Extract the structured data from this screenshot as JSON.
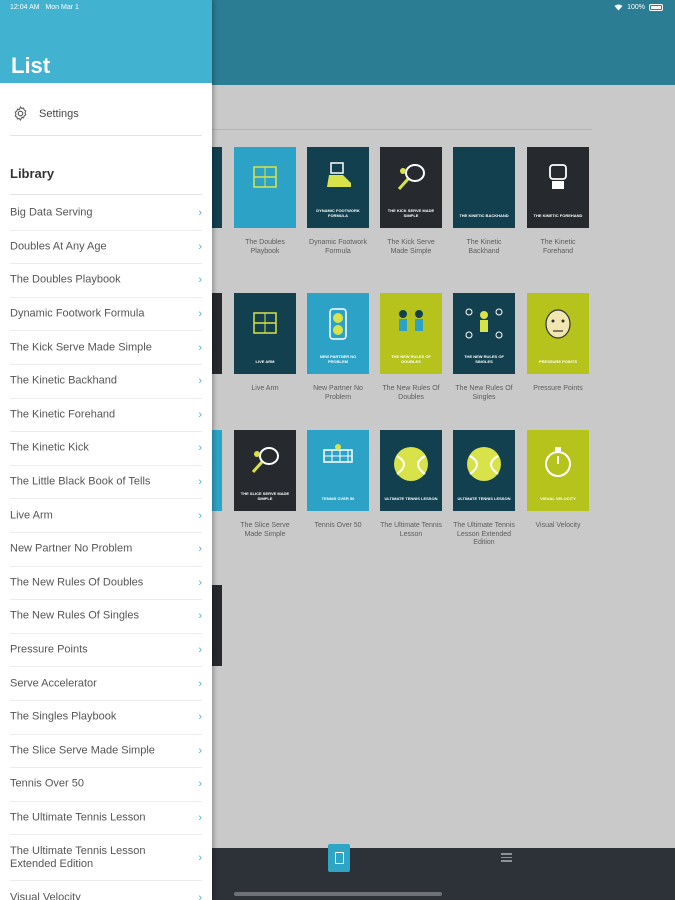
{
  "status_bar": {
    "time": "12:04 AM",
    "date": "Mon Mar 1",
    "battery": "100%"
  },
  "drawer": {
    "title": "List",
    "settings_label": "Settings",
    "library_heading": "Library",
    "items": [
      "Big Data Serving",
      "Doubles At Any Age",
      "The Doubles Playbook",
      "Dynamic Footwork Formula",
      "The Kick Serve Made Simple",
      "The Kinetic Backhand",
      "The Kinetic Forehand",
      "The Kinetic Kick",
      "The Little Black Book of Tells",
      "Live Arm",
      "New Partner No Problem",
      "The New Rules Of Doubles",
      "The New Rules Of Singles",
      "Pressure Points",
      "Serve Accelerator",
      "The Singles Playbook",
      "The Slice Serve Made Simple",
      "Tennis Over 50",
      "The Ultimate Tennis Lesson",
      "The Ultimate Tennis Lesson Extended Edition",
      "Visual Velocity"
    ]
  },
  "grid": {
    "row1": [
      {
        "caption": "The Doubles Playbook",
        "cover_text": "",
        "color": "cyan",
        "icon": "court-icon"
      },
      {
        "caption": "Dynamic Footwork Formula",
        "cover_text": "DYNAMIC FOOTWORK FORMULA",
        "color": "navy",
        "icon": "shoe-icon"
      },
      {
        "caption": "The Kick Serve Made Simple",
        "cover_text": "THE KICK SERVE MADE SIMPLE",
        "color": "dark",
        "icon": "racket-icon"
      },
      {
        "caption": "The Kinetic Backhand",
        "cover_text": "THE KINETIC BACKHAND",
        "color": "navy",
        "icon": ""
      },
      {
        "caption": "The Kinetic Forehand",
        "cover_text": "THE KINETIC FOREHAND",
        "color": "dark",
        "icon": "fist-icon"
      }
    ],
    "row2": [
      {
        "caption": "Live Arm",
        "cover_text": "LIVE ARM",
        "color": "navy",
        "icon": "court-icon"
      },
      {
        "caption": "New Partner No Problem",
        "cover_text": "NEW PARTNER NO PROBLEM",
        "color": "cyan",
        "icon": "balls-icon"
      },
      {
        "caption": "The New Rules Of Doubles",
        "cover_text": "THE NEW RULES OF DOUBLES",
        "color": "lime",
        "icon": "players-icon"
      },
      {
        "caption": "The New Rules Of Singles",
        "cover_text": "THE NEW RULES OF SINGLES",
        "color": "navy",
        "icon": "player-icon"
      },
      {
        "caption": "Pressure Points",
        "cover_text": "PRESSURE POINTS",
        "color": "lime",
        "icon": "face-icon"
      }
    ],
    "row3": [
      {
        "caption": "The Slice Serve Made Simple",
        "cover_text": "THE SLICE SERVE MADE SIMPLE",
        "color": "dark",
        "icon": "racket-icon"
      },
      {
        "caption": "Tennis Over 50",
        "cover_text": "TENNIS OVER 50",
        "color": "cyan",
        "icon": "net-icon"
      },
      {
        "caption": "The Ultimate Tennis Lesson",
        "cover_text": "ULTIMATE TENNIS LESSON",
        "color": "navy",
        "icon": "ball-icon"
      },
      {
        "caption": "The Ultimate Tennis Lesson Extended Edition",
        "cover_text": "ULTIMATE TENNIS LESSON",
        "color": "navy",
        "icon": "ball-icon"
      },
      {
        "caption": "Visual Velocity",
        "cover_text": "VISUAL VELOCITY",
        "color": "lime",
        "icon": "stopwatch-icon"
      }
    ]
  },
  "colors": {
    "header": "#2a7d93",
    "drawer_header": "#41b2cf",
    "accent": "#4ab2cb",
    "tab_bar": "#2d3238"
  }
}
